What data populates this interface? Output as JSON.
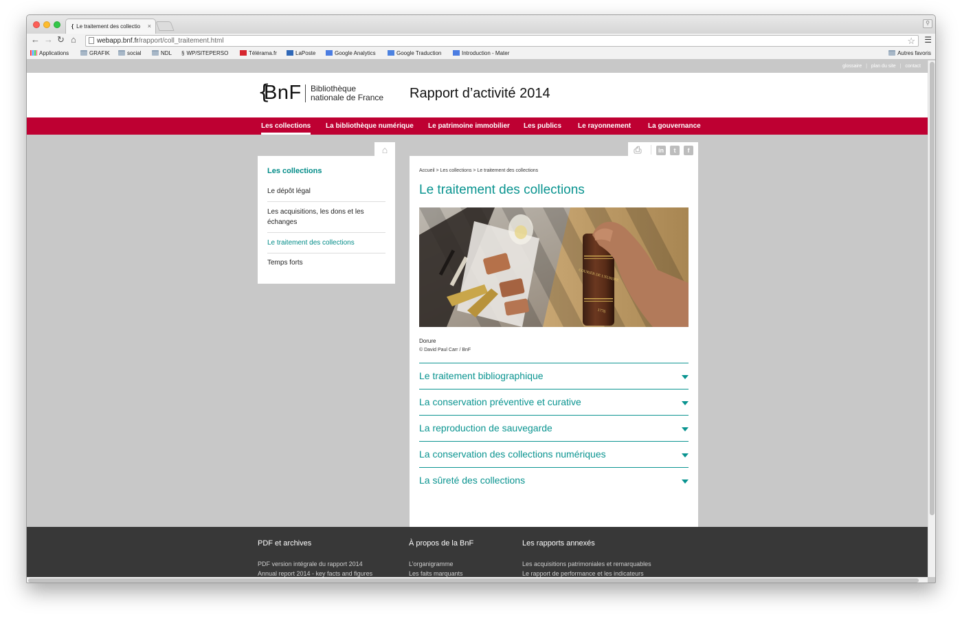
{
  "browser": {
    "tab_title": "Le traitement des collectio",
    "tab_close": "×",
    "url_domain": "webapp.bnf.fr",
    "url_path": "/rapport/coll_traitement.html",
    "bookmarks": [
      "Applications",
      "GRAFIK",
      "social",
      "NDL",
      "WP/SITEPERSO",
      "Télérama.fr",
      "LaPoste",
      "Google Analytics",
      "Google Traduction",
      "Introduction - Mater"
    ],
    "bookmarks_right": "Autres favoris"
  },
  "utility_links": [
    "glossaire",
    "plan du site",
    "contact"
  ],
  "header": {
    "logo_text": "BnF",
    "logo_line1": "Bibliothèque",
    "logo_line2": "nationale de France",
    "report_title": "Rapport d’activité 2014"
  },
  "nav": [
    "Les collections",
    "La bibliothèque numérique",
    "Le patrimoine immobilier",
    "Les publics",
    "Le rayonnement",
    "La gouvernance"
  ],
  "sidebar": {
    "title": "Les collections",
    "items": [
      "Le dépôt légal",
      "Les acquisitions, les dons et les échanges",
      "Le traitement des collections",
      "Temps forts"
    ]
  },
  "main": {
    "breadcrumb": "Accueil > Les collections > Le traitement des collections",
    "title": "Le traitement des collections",
    "caption": "Dorure",
    "credit": "© David Paul Carr / BnF",
    "book_label": "COURIER DE L'EUROPE",
    "book_year": "1776",
    "accordion": [
      "Le traitement bibliographique",
      "La conservation préventive et curative",
      "La reproduction de sauvegarde",
      "La conservation des collections numériques",
      "La sûreté des collections"
    ]
  },
  "footer": {
    "col1": {
      "title": "PDF et archives",
      "links": [
        "PDF version intégrale du rapport 2014",
        "Annual report 2014 - key facts and figures"
      ]
    },
    "col2": {
      "title": "À propos de la BnF",
      "links": [
        "L’organigramme",
        "Les faits marquants"
      ]
    },
    "col3": {
      "title": "Les rapports annexés",
      "links": [
        "Les acquisitions patrimoniales et remarquables",
        "Le rapport de performance et les indicateurs"
      ]
    }
  },
  "colors": {
    "accent": "#0a9490",
    "nav_red": "#be0032",
    "footer": "#383838",
    "page_bg": "#c8c8c8"
  }
}
